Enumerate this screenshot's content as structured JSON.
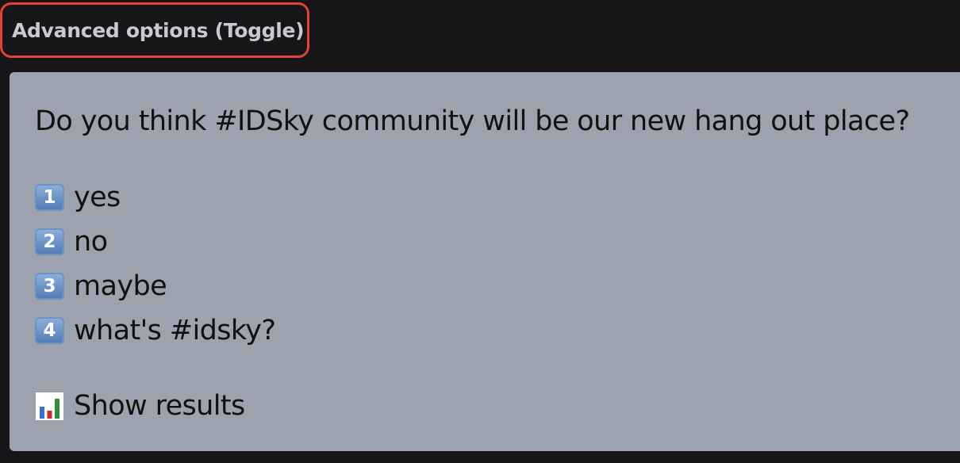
{
  "toggle": {
    "label": "Advanced options (Toggle)"
  },
  "poll": {
    "question": "Do you think #IDSky community will be our new hang out place?",
    "options": [
      {
        "key": "1",
        "label": "yes",
        "icon": "keycap-one-icon"
      },
      {
        "key": "2",
        "label": "no",
        "icon": "keycap-two-icon"
      },
      {
        "key": "3",
        "label": "maybe",
        "icon": "keycap-three-icon"
      },
      {
        "key": "4",
        "label": "what's #idsky?",
        "icon": "keycap-four-icon"
      }
    ],
    "results_label": "Show results",
    "results_icon": "bar-chart-icon"
  },
  "colors": {
    "background": "#161618",
    "highlight_border": "#e5432f",
    "card": "#9ca3ae",
    "keycap": "#5b83bb"
  }
}
